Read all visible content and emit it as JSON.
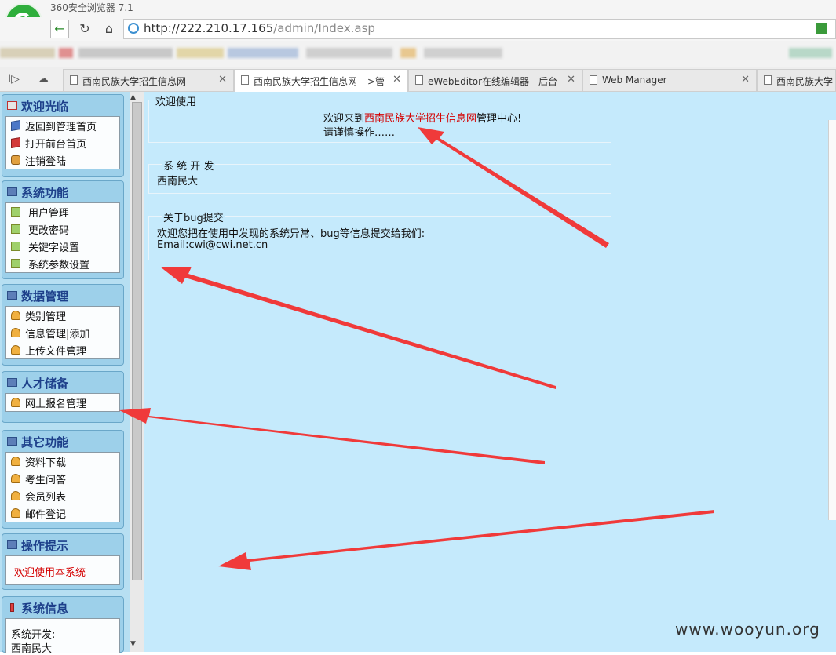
{
  "browser": {
    "title": "360安全浏览器 7.1",
    "url_host": "http://222.210.17.165",
    "url_path": "/admin/Index.asp"
  },
  "tabs": [
    {
      "label": "西南民族大学招生信息网"
    },
    {
      "label": "西南民族大学招生信息网--->管"
    },
    {
      "label": "eWebEditor在线编辑器 - 后台"
    },
    {
      "label": "Web Manager"
    },
    {
      "label": "西南民族大学"
    }
  ],
  "menu": {
    "welcome": {
      "title": "欢迎光临",
      "items": [
        "返回到管理首页",
        "打开前台首页",
        "注销登陆"
      ]
    },
    "system": {
      "title": "系统功能",
      "items": [
        "用户管理",
        "更改密码",
        "关键字设置",
        "系统参数设置"
      ]
    },
    "data": {
      "title": "数据管理",
      "items": [
        "类别管理",
        "信息管理|添加",
        "上传文件管理"
      ]
    },
    "talent": {
      "title": "人才储备",
      "items": [
        "网上报名管理"
      ]
    },
    "other": {
      "title": "其它功能",
      "items": [
        "资料下载",
        "考生问答",
        "会员列表",
        "邮件登记"
      ]
    },
    "tips": {
      "title": "操作提示",
      "text": "欢迎使用本系统"
    },
    "info": {
      "title": "系统信息",
      "line1": "系统开发:",
      "line2": "西南民大"
    }
  },
  "content": {
    "welcome": {
      "legend": "欢迎使用",
      "prefix": "欢迎来到",
      "site": "西南民族大学招生信息网",
      "suffix": "管理中心!",
      "line2": "请谨慎操作……"
    },
    "dev": {
      "legend": "系 统 开 发",
      "text": "西南民大"
    },
    "bug": {
      "legend": "关于bug提交",
      "line1": "欢迎您把在使用中发现的系统异常、bug等信息提交给我们:",
      "line2": "Email:cwi@cwi.net.cn"
    }
  },
  "watermark": "www.wooyun.org",
  "colors": {
    "annotation": "#f03a3a",
    "page_bg": "#c5eafc",
    "menu_title": "#1d3f8a",
    "link_red": "#d40000"
  }
}
